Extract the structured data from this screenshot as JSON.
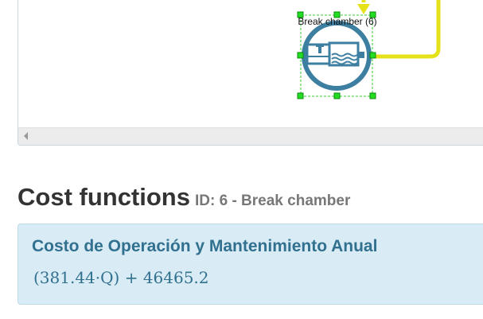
{
  "diagram": {
    "node_label": "Break chamber (6)",
    "node_icon": "break-chamber-icon",
    "colors": {
      "connector": "#e6e21a",
      "node_ring": "#3d7fa0",
      "handle": "#22dd22",
      "selection": "#33cc33"
    }
  },
  "cost_section": {
    "title": "Cost functions",
    "subtitle": "ID: 6 - Break chamber",
    "panel_title": "Costo de Operación y Mantenimiento Anual",
    "formula": "(381.44·Q) + 46465.2"
  }
}
